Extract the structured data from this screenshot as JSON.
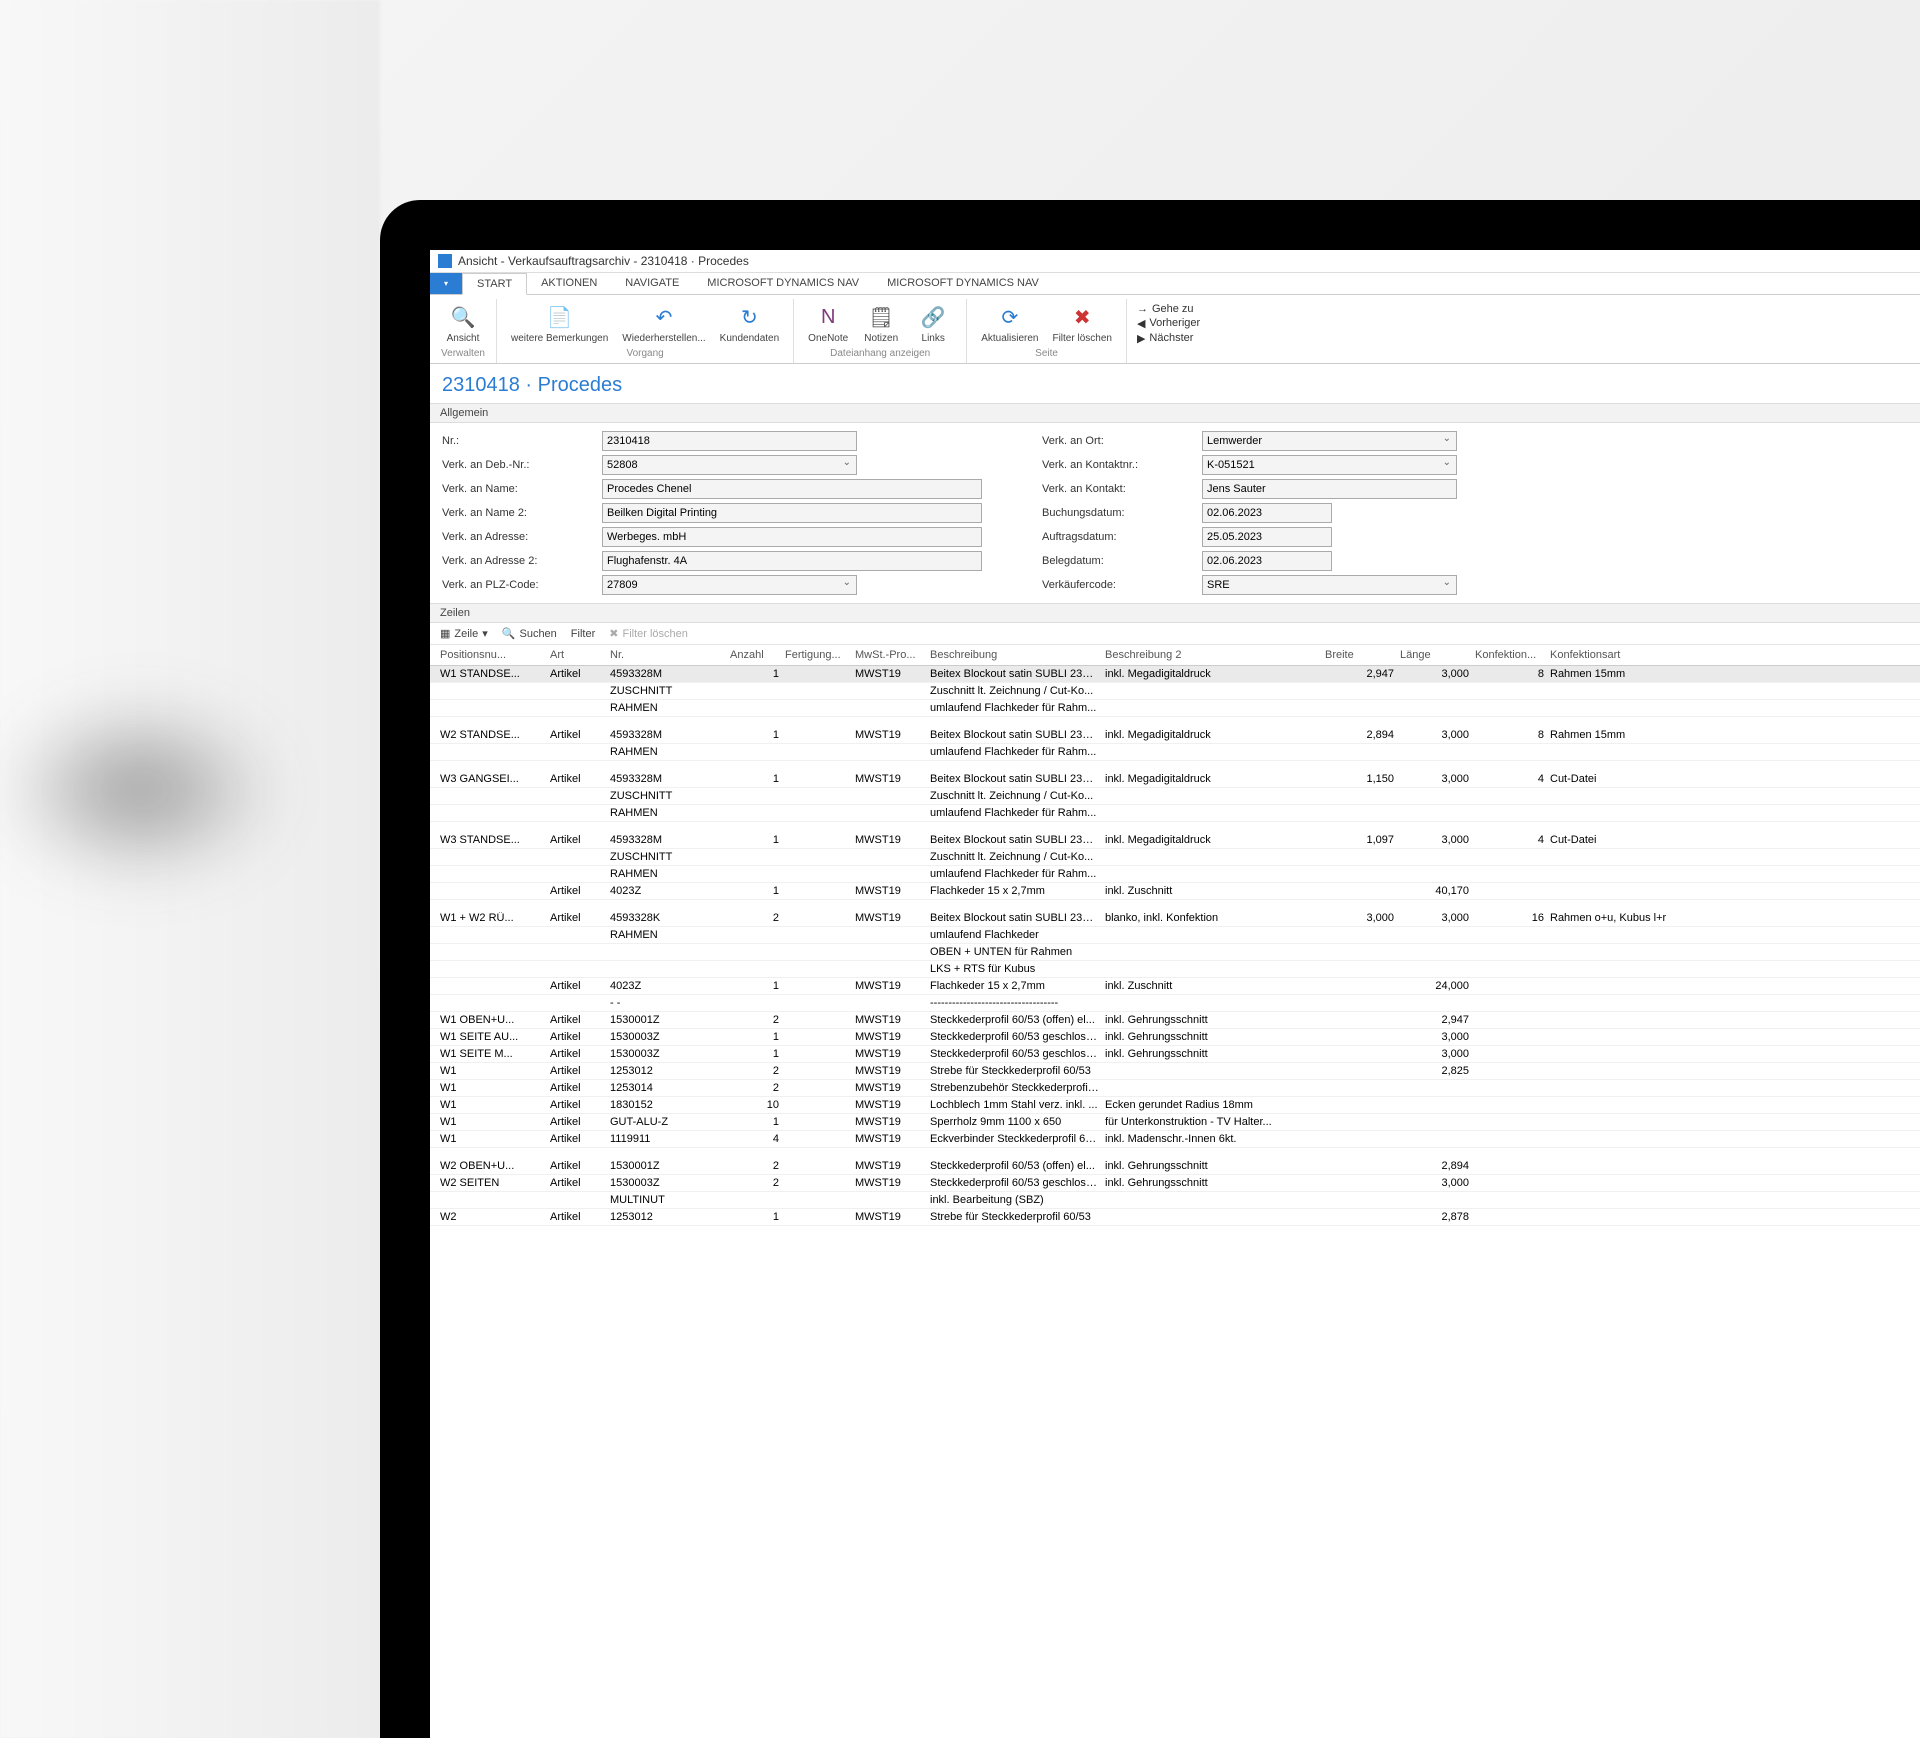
{
  "window": {
    "title": "Ansicht - Verkaufsauftragsarchiv - 2310418 · Procedes"
  },
  "menu": {
    "file": "",
    "tabs": [
      "START",
      "AKTIONEN",
      "NAVIGATE",
      "MICROSOFT DYNAMICS NAV",
      "MICROSOFT DYNAMICS NAV"
    ]
  },
  "ribbon": {
    "verwalten": {
      "ansicht": "Ansicht",
      "label": "Verwalten"
    },
    "vorgang": {
      "bemerkungen": "weitere Bemerkungen",
      "wieder": "Wiederherstellen...",
      "kunden": "Kundendaten",
      "label": "Vorgang"
    },
    "datei": {
      "onenote": "OneNote",
      "notizen": "Notizen",
      "links": "Links",
      "label": "Dateianhang anzeigen"
    },
    "seite": {
      "aktual": "Aktualisieren",
      "filter": "Filter löschen",
      "label": "Seite"
    },
    "nav": {
      "gehe": "Gehe zu",
      "vorh": "Vorheriger",
      "naech": "Nächster"
    }
  },
  "docTitle": "2310418 · Procedes",
  "sections": {
    "allgemein": "Allgemein",
    "zeilen": "Zeilen"
  },
  "form": {
    "left": [
      {
        "label": "Nr.:",
        "value": "2310418",
        "type": "text",
        "w": "w1"
      },
      {
        "label": "Verk. an Deb.-Nr.:",
        "value": "52808",
        "type": "select",
        "w": "w1"
      },
      {
        "label": "Verk. an Name:",
        "value": "Procedes Chenel",
        "type": "text",
        "w": "w2"
      },
      {
        "label": "Verk. an Name 2:",
        "value": "Beilken Digital Printing",
        "type": "text",
        "w": "w2"
      },
      {
        "label": "Verk. an Adresse:",
        "value": "Werbeges. mbH",
        "type": "text",
        "w": "w2"
      },
      {
        "label": "Verk. an Adresse 2:",
        "value": "Flughafenstr. 4A",
        "type": "text",
        "w": "w2"
      },
      {
        "label": "Verk. an PLZ-Code:",
        "value": "27809",
        "type": "select",
        "w": "w1"
      }
    ],
    "right": [
      {
        "label": "Verk. an Ort:",
        "value": "Lemwerder",
        "type": "select",
        "w": "w1"
      },
      {
        "label": "Verk. an Kontaktnr.:",
        "value": "K-051521",
        "type": "select",
        "w": "w1"
      },
      {
        "label": "Verk. an Kontakt:",
        "value": "Jens Sauter",
        "type": "text",
        "w": "w1"
      },
      {
        "label": "Buchungsdatum:",
        "value": "02.06.2023",
        "type": "text",
        "w": "w3"
      },
      {
        "label": "Auftragsdatum:",
        "value": "25.05.2023",
        "type": "text",
        "w": "w3"
      },
      {
        "label": "Belegdatum:",
        "value": "02.06.2023",
        "type": "text",
        "w": "w3"
      },
      {
        "label": "Verkäufercode:",
        "value": "SRE",
        "type": "select",
        "w": "w1"
      }
    ]
  },
  "linesToolbar": {
    "zeile": "Zeile",
    "suchen": "Suchen",
    "filter": "Filter",
    "filterLoeschen": "Filter löschen"
  },
  "columns": [
    "Positionsnu...",
    "Art",
    "Nr.",
    "Anzahl",
    "Fertigung...",
    "MwSt.-Pro...",
    "Beschreibung",
    "Beschreibung 2",
    "Breite",
    "Länge",
    "Konfektion...",
    "Konfektionsart"
  ],
  "rows": [
    {
      "sel": true,
      "pos": "W1 STANDSE...",
      "art": "Artikel",
      "nr": "4593328M",
      "anz": "1",
      "fert": "",
      "mwst": "MWST19",
      "b1": "Beitex Blockout satin SUBLI 235g...",
      "b2": "inkl. Megadigitaldruck",
      "breite": "2,947",
      "laenge": "3,000",
      "konf": "8",
      "konfa": "Rahmen 15mm"
    },
    {
      "pos": "",
      "art": "",
      "nr": "ZUSCHNITT",
      "anz": "",
      "fert": "",
      "mwst": "",
      "b1": "Zuschnitt lt. Zeichnung / Cut-Ko...",
      "b2": "",
      "breite": "",
      "laenge": "",
      "konf": "",
      "konfa": ""
    },
    {
      "pos": "",
      "art": "",
      "nr": "RAHMEN",
      "anz": "",
      "fert": "",
      "mwst": "",
      "b1": "umlaufend Flachkeder für Rahm...",
      "b2": "",
      "breite": "",
      "laenge": "",
      "konf": "",
      "konfa": ""
    },
    {
      "spacer": true
    },
    {
      "pos": "W2 STANDSE...",
      "art": "Artikel",
      "nr": "4593328M",
      "anz": "1",
      "fert": "",
      "mwst": "MWST19",
      "b1": "Beitex Blockout satin SUBLI 235g...",
      "b2": "inkl. Megadigitaldruck",
      "breite": "2,894",
      "laenge": "3,000",
      "konf": "8",
      "konfa": "Rahmen 15mm"
    },
    {
      "pos": "",
      "art": "",
      "nr": "RAHMEN",
      "anz": "",
      "fert": "",
      "mwst": "",
      "b1": "umlaufend Flachkeder für Rahm...",
      "b2": "",
      "breite": "",
      "laenge": "",
      "konf": "",
      "konfa": ""
    },
    {
      "spacer": true
    },
    {
      "pos": "W3 GANGSEI...",
      "art": "Artikel",
      "nr": "4593328M",
      "anz": "1",
      "fert": "",
      "mwst": "MWST19",
      "b1": "Beitex Blockout satin SUBLI 235g...",
      "b2": "inkl. Megadigitaldruck",
      "breite": "1,150",
      "laenge": "3,000",
      "konf": "4",
      "konfa": "Cut-Datei"
    },
    {
      "pos": "",
      "art": "",
      "nr": "ZUSCHNITT",
      "anz": "",
      "fert": "",
      "mwst": "",
      "b1": "Zuschnitt lt. Zeichnung / Cut-Ko...",
      "b2": "",
      "breite": "",
      "laenge": "",
      "konf": "",
      "konfa": ""
    },
    {
      "pos": "",
      "art": "",
      "nr": "RAHMEN",
      "anz": "",
      "fert": "",
      "mwst": "",
      "b1": "umlaufend Flachkeder für Rahm...",
      "b2": "",
      "breite": "",
      "laenge": "",
      "konf": "",
      "konfa": ""
    },
    {
      "spacer": true
    },
    {
      "pos": "W3 STANDSE...",
      "art": "Artikel",
      "nr": "4593328M",
      "anz": "1",
      "fert": "",
      "mwst": "MWST19",
      "b1": "Beitex Blockout satin SUBLI 235g...",
      "b2": "inkl. Megadigitaldruck",
      "breite": "1,097",
      "laenge": "3,000",
      "konf": "4",
      "konfa": "Cut-Datei"
    },
    {
      "pos": "",
      "art": "",
      "nr": "ZUSCHNITT",
      "anz": "",
      "fert": "",
      "mwst": "",
      "b1": "Zuschnitt lt. Zeichnung / Cut-Ko...",
      "b2": "",
      "breite": "",
      "laenge": "",
      "konf": "",
      "konfa": ""
    },
    {
      "pos": "",
      "art": "",
      "nr": "RAHMEN",
      "anz": "",
      "fert": "",
      "mwst": "",
      "b1": "umlaufend Flachkeder für Rahm...",
      "b2": "",
      "breite": "",
      "laenge": "",
      "konf": "",
      "konfa": ""
    },
    {
      "pos": "",
      "art": "Artikel",
      "nr": "4023Z",
      "anz": "1",
      "fert": "",
      "mwst": "MWST19",
      "b1": "Flachkeder 15 x 2,7mm",
      "b2": "inkl. Zuschnitt",
      "breite": "",
      "laenge": "40,170",
      "konf": "",
      "konfa": ""
    },
    {
      "spacer": true
    },
    {
      "pos": "W1 + W2 RÜ...",
      "art": "Artikel",
      "nr": "4593328K",
      "anz": "2",
      "fert": "",
      "mwst": "MWST19",
      "b1": "Beitex Blockout satin SUBLI 235g...",
      "b2": "blanko, inkl. Konfektion",
      "breite": "3,000",
      "laenge": "3,000",
      "konf": "16",
      "konfa": "Rahmen o+u, Kubus l+r"
    },
    {
      "pos": "",
      "art": "",
      "nr": "RAHMEN",
      "anz": "",
      "fert": "",
      "mwst": "",
      "b1": "umlaufend Flachkeder",
      "b2": "",
      "breite": "",
      "laenge": "",
      "konf": "",
      "konfa": ""
    },
    {
      "pos": "",
      "art": "",
      "nr": "",
      "anz": "",
      "fert": "",
      "mwst": "",
      "b1": "OBEN + UNTEN für Rahmen",
      "b2": "",
      "breite": "",
      "laenge": "",
      "konf": "",
      "konfa": ""
    },
    {
      "pos": "",
      "art": "",
      "nr": "",
      "anz": "",
      "fert": "",
      "mwst": "",
      "b1": "LKS + RTS für Kubus",
      "b2": "",
      "breite": "",
      "laenge": "",
      "konf": "",
      "konfa": ""
    },
    {
      "pos": "",
      "art": "Artikel",
      "nr": "4023Z",
      "anz": "1",
      "fert": "",
      "mwst": "MWST19",
      "b1": "Flachkeder 15 x 2,7mm",
      "b2": "inkl. Zuschnitt",
      "breite": "",
      "laenge": "24,000",
      "konf": "",
      "konfa": ""
    },
    {
      "pos": "",
      "art": "",
      "nr": "- -",
      "anz": "",
      "fert": "",
      "mwst": "",
      "b1": "-----------------------------------",
      "b2": "",
      "breite": "",
      "laenge": "",
      "konf": "",
      "konfa": ""
    },
    {
      "pos": "W1 OBEN+U...",
      "art": "Artikel",
      "nr": "1530001Z",
      "anz": "2",
      "fert": "",
      "mwst": "MWST19",
      "b1": "Steckkederprofil 60/53 (offen) el...",
      "b2": "inkl. Gehrungsschnitt",
      "breite": "",
      "laenge": "2,947",
      "konf": "",
      "konfa": ""
    },
    {
      "pos": "W1 SEITE AU...",
      "art": "Artikel",
      "nr": "1530003Z",
      "anz": "1",
      "fert": "",
      "mwst": "MWST19",
      "b1": "Steckkederprofil 60/53 geschloss...",
      "b2": "inkl. Gehrungsschnitt",
      "breite": "",
      "laenge": "3,000",
      "konf": "",
      "konfa": ""
    },
    {
      "pos": "W1 SEITE M...",
      "art": "Artikel",
      "nr": "1530003Z",
      "anz": "1",
      "fert": "",
      "mwst": "MWST19",
      "b1": "Steckkederprofil 60/53 geschloss...",
      "b2": "inkl. Gehrungsschnitt",
      "breite": "",
      "laenge": "3,000",
      "konf": "",
      "konfa": ""
    },
    {
      "pos": "W1",
      "art": "Artikel",
      "nr": "1253012",
      "anz": "2",
      "fert": "",
      "mwst": "MWST19",
      "b1": "Strebe für Steckkederprofil 60/53",
      "b2": "",
      "breite": "",
      "laenge": "2,825",
      "konf": "",
      "konfa": ""
    },
    {
      "pos": "W1",
      "art": "Artikel",
      "nr": "1253014",
      "anz": "2",
      "fert": "",
      "mwst": "MWST19",
      "b1": "Strebenzubehör Steckkederprofil...",
      "b2": "",
      "breite": "",
      "laenge": "",
      "konf": "",
      "konfa": ""
    },
    {
      "pos": "W1",
      "art": "Artikel",
      "nr": "1830152",
      "anz": "10",
      "fert": "",
      "mwst": "MWST19",
      "b1": "Lochblech 1mm Stahl verz. inkl. ...",
      "b2": "Ecken gerundet Radius 18mm",
      "breite": "",
      "laenge": "",
      "konf": "",
      "konfa": ""
    },
    {
      "pos": "W1",
      "art": "Artikel",
      "nr": "GUT-ALU-Z",
      "anz": "1",
      "fert": "",
      "mwst": "MWST19",
      "b1": "Sperrholz 9mm 1100 x 650",
      "b2": "für Unterkonstruktion - TV Halter...",
      "breite": "",
      "laenge": "",
      "konf": "",
      "konfa": ""
    },
    {
      "pos": "W1",
      "art": "Artikel",
      "nr": "1119911",
      "anz": "4",
      "fert": "",
      "mwst": "MWST19",
      "b1": "Eckverbinder Steckkederprofil 60...",
      "b2": "inkl. Madenschr.-Innen 6kt.",
      "breite": "",
      "laenge": "",
      "konf": "",
      "konfa": ""
    },
    {
      "spacer": true
    },
    {
      "pos": "W2 OBEN+U...",
      "art": "Artikel",
      "nr": "1530001Z",
      "anz": "2",
      "fert": "",
      "mwst": "MWST19",
      "b1": "Steckkederprofil 60/53 (offen) el...",
      "b2": "inkl. Gehrungsschnitt",
      "breite": "",
      "laenge": "2,894",
      "konf": "",
      "konfa": ""
    },
    {
      "pos": "W2 SEITEN",
      "art": "Artikel",
      "nr": "1530003Z",
      "anz": "2",
      "fert": "",
      "mwst": "MWST19",
      "b1": "Steckkederprofil 60/53 geschloss...",
      "b2": "inkl. Gehrungsschnitt",
      "breite": "",
      "laenge": "3,000",
      "konf": "",
      "konfa": ""
    },
    {
      "pos": "",
      "art": "",
      "nr": "MULTINUT",
      "anz": "",
      "fert": "",
      "mwst": "",
      "b1": "inkl. Bearbeitung (SBZ)",
      "b2": "",
      "breite": "",
      "laenge": "",
      "konf": "",
      "konfa": ""
    },
    {
      "pos": "W2",
      "art": "Artikel",
      "nr": "1253012",
      "anz": "1",
      "fert": "",
      "mwst": "MWST19",
      "b1": "Strebe für Steckkederprofil 60/53",
      "b2": "",
      "breite": "",
      "laenge": "2,878",
      "konf": "",
      "konfa": ""
    }
  ]
}
